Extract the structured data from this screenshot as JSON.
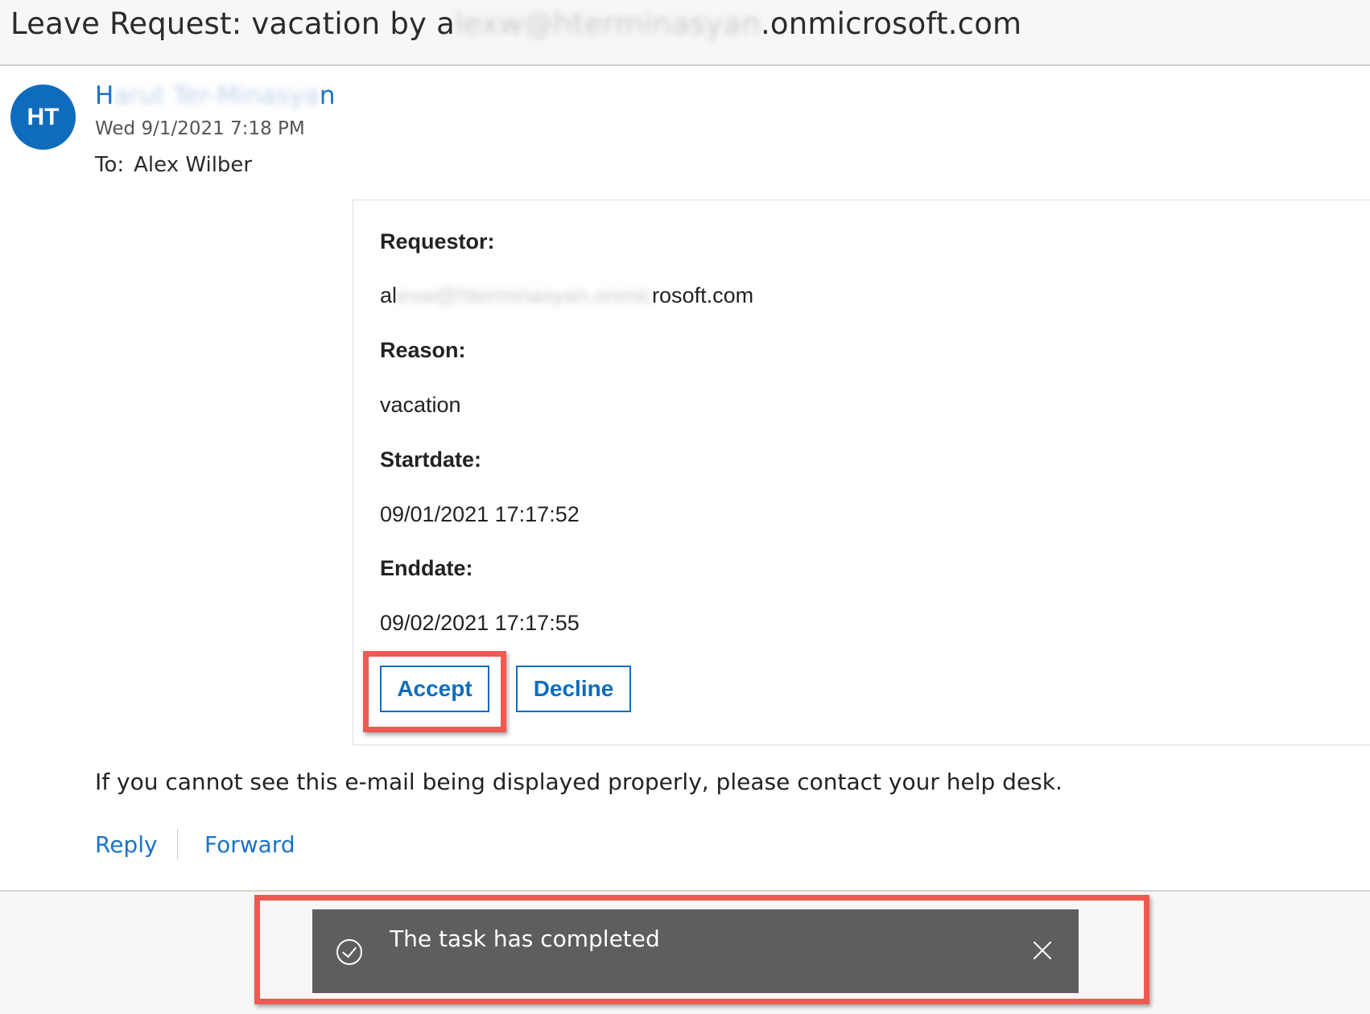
{
  "email": {
    "subject_prefix": "Leave Request: vacation by a",
    "subject_redacted": "lexw@hterminasyan",
    "subject_suffix": ".onmicrosoft.com",
    "avatar_initials": "HT",
    "sender_first": "H",
    "sender_redacted": "arut Ter-Minasya",
    "sender_last": "n",
    "sent_date": "Wed 9/1/2021 7:18 PM",
    "to_label": "To:",
    "to_name": "Alex Wilber"
  },
  "card": {
    "requestor_label": "Requestor:",
    "requestor_prefix": "al",
    "requestor_redacted": "exw@hterminasyan.onmic",
    "requestor_suffix": "rosoft.com",
    "reason_label": "Reason:",
    "reason_value": "vacation",
    "startdate_label": "Startdate:",
    "startdate_value": "09/01/2021 17:17:52",
    "enddate_label": "Enddate:",
    "enddate_value": "09/02/2021 17:17:55",
    "accept_label": "Accept",
    "decline_label": "Decline"
  },
  "footer": {
    "note": "If you cannot see this e-mail being displayed properly, please contact your help desk.",
    "reply_label": "Reply",
    "forward_label": "Forward"
  },
  "toast": {
    "icon": "check-circle-icon",
    "message": "The task has completed",
    "close_icon": "close-icon"
  },
  "colors": {
    "accent": "#0f6cbd",
    "highlight": "#ef5a50",
    "toast_bg": "#5e5e5e"
  }
}
